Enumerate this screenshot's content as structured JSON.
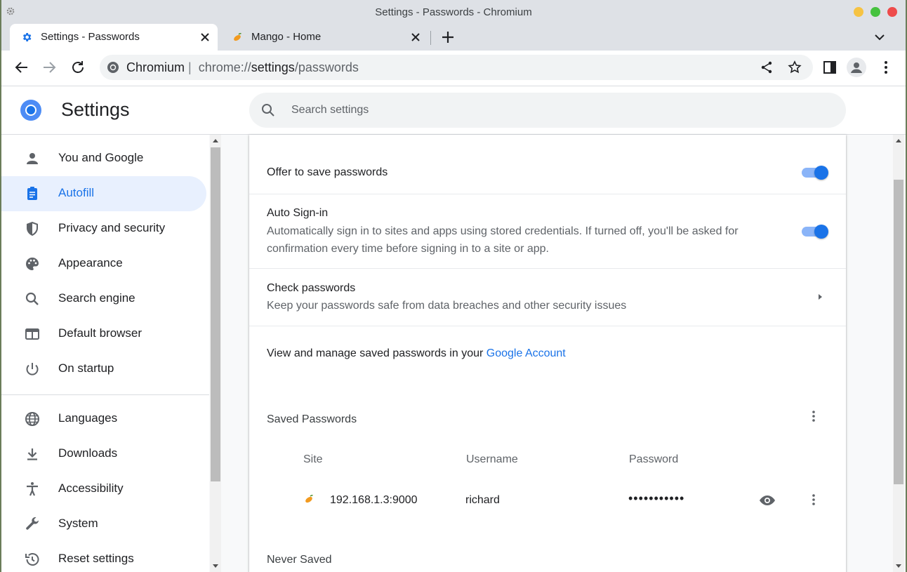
{
  "window": {
    "title": "Settings - Passwords - Chromium",
    "traffic_colors": {
      "minimize": "#f6c343",
      "maximize": "#46c23f",
      "close": "#ee4b4b"
    }
  },
  "tabs": [
    {
      "label": "Settings - Passwords",
      "icon": "gear-icon",
      "active": true
    },
    {
      "label": "Mango - Home",
      "icon": "mango-icon",
      "active": false
    }
  ],
  "toolbar": {
    "omnibox_host": "Chromium",
    "omnibox_separator": "|",
    "url_scheme": "chrome://",
    "url_path_main": "settings",
    "url_path_rest": "/passwords"
  },
  "header": {
    "title": "Settings",
    "search_placeholder": "Search settings"
  },
  "sidebar": {
    "items": [
      {
        "label": "You and Google",
        "icon": "person-icon"
      },
      {
        "label": "Autofill",
        "icon": "clipboard-icon",
        "active": true
      },
      {
        "label": "Privacy and security",
        "icon": "shield-icon"
      },
      {
        "label": "Appearance",
        "icon": "palette-icon"
      },
      {
        "label": "Search engine",
        "icon": "search-icon"
      },
      {
        "label": "Default browser",
        "icon": "browser-icon"
      },
      {
        "label": "On startup",
        "icon": "power-icon"
      },
      {
        "label": "Languages",
        "icon": "globe-icon"
      },
      {
        "label": "Downloads",
        "icon": "download-icon"
      },
      {
        "label": "Accessibility",
        "icon": "accessibility-icon"
      },
      {
        "label": "System",
        "icon": "wrench-icon"
      },
      {
        "label": "Reset settings",
        "icon": "history-icon"
      }
    ]
  },
  "passwords": {
    "offer_save": {
      "label": "Offer to save passwords",
      "enabled": true
    },
    "auto_signin": {
      "label": "Auto Sign-in",
      "description": "Automatically sign in to sites and apps using stored credentials. If turned off, you'll be asked for confirmation every time before signing in to a site or app.",
      "enabled": true
    },
    "check": {
      "label": "Check passwords",
      "description": "Keep your passwords safe from data breaches and other security issues"
    },
    "manage_text": "View and manage saved passwords in your",
    "manage_link": "Google Account",
    "saved_title": "Saved Passwords",
    "columns": {
      "site": "Site",
      "username": "Username",
      "password": "Password"
    },
    "entries": [
      {
        "site": "192.168.1.3:9000",
        "username": "richard",
        "password": "•••••••••••"
      }
    ],
    "never_saved_title": "Never Saved"
  },
  "colors": {
    "accent": "#1a73e8",
    "active_nav_bg": "#e8f0fe",
    "toggle_track": "#8ab4f8"
  }
}
